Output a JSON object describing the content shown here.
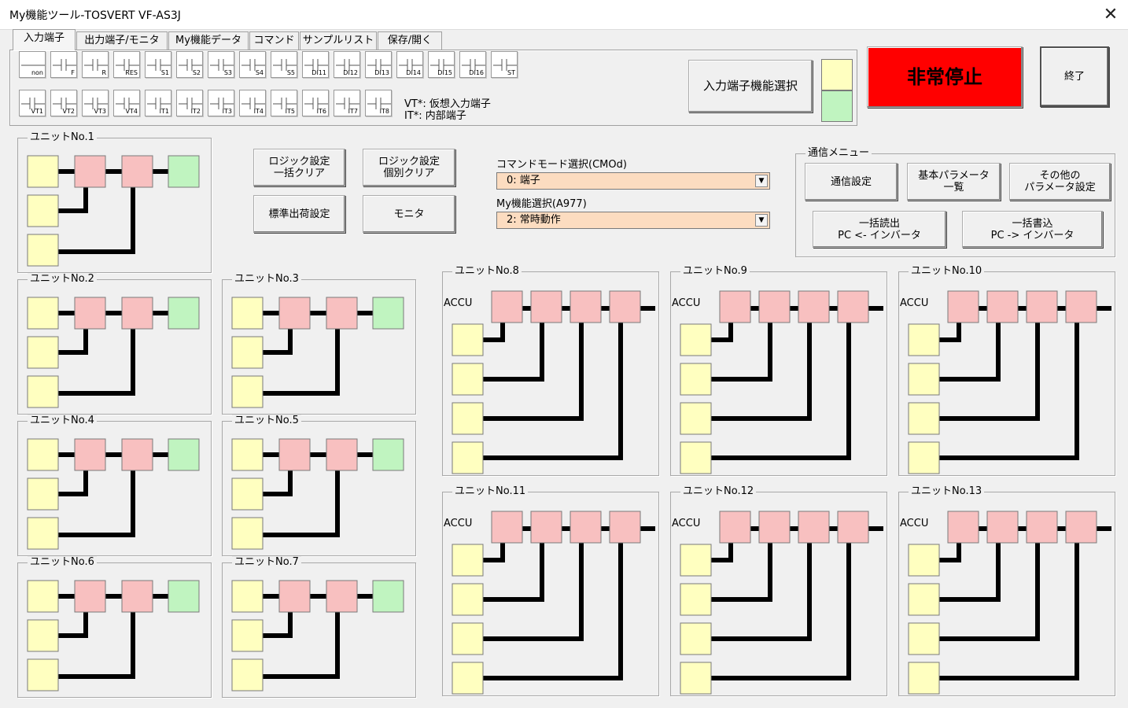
{
  "window": {
    "title": "My機能ツール-TOSVERT VF-AS3J",
    "close_glyph": "✕"
  },
  "tabs": [
    {
      "label": "入力端子",
      "active": true
    },
    {
      "label": "出力端子/モニタ",
      "active": false
    },
    {
      "label": "My機能データ",
      "active": false
    },
    {
      "label": "コマンド",
      "active": false
    },
    {
      "label": "サンプルリスト",
      "active": false
    },
    {
      "label": "保存/開く",
      "active": false
    }
  ],
  "terminals_row1": [
    "non",
    "F",
    "R",
    "RES",
    "S1",
    "S2",
    "S3",
    "S4",
    "S5",
    "DI11",
    "DI12",
    "DI13",
    "DI14",
    "DI15",
    "DI16",
    "ST"
  ],
  "terminals_row2": [
    "VT1",
    "VT2",
    "VT3",
    "VT4",
    "IT1",
    "IT2",
    "IT3",
    "IT4",
    "IT5",
    "IT6",
    "IT7",
    "IT8"
  ],
  "legend": {
    "vt": "VT*: 仮想入力端子",
    "it": "IT*: 内部端子"
  },
  "input_func_button": "入力端子機能選択",
  "emergency_button": "非常停止",
  "exit_button": "終了",
  "logic_buttons": {
    "bulk_clear": "ロジック設定\n一括クリア",
    "individual_clear": "ロジック設定\n個別クリア",
    "factory": "標準出荷設定",
    "monitor": "モニタ"
  },
  "command_mode": {
    "label": "コマンドモード選択(CMOd)",
    "value": "0: 端子"
  },
  "my_function": {
    "label": "My機能選択(A977)",
    "value": "2: 常時動作"
  },
  "comm_menu": {
    "title": "通信メニュー",
    "settings": "通信設定",
    "basic_params": "基本パラメータ\n一覧",
    "other_params": "その他の\nパラメータ設定",
    "bulk_read": "一括読出\nPC <- インバータ",
    "bulk_write": "一括書込\nPC -> インバータ"
  },
  "small_units": [
    {
      "title": "ユニットNo.1"
    },
    {
      "title": "ユニットNo.2"
    },
    {
      "title": "ユニットNo.3"
    },
    {
      "title": "ユニットNo.4"
    },
    {
      "title": "ユニットNo.5"
    },
    {
      "title": "ユニットNo.6"
    },
    {
      "title": "ユニットNo.7"
    }
  ],
  "large_units": [
    {
      "title": "ユニットNo.8"
    },
    {
      "title": "ユニットNo.9"
    },
    {
      "title": "ユニットNo.10"
    },
    {
      "title": "ユニットNo.11"
    },
    {
      "title": "ユニットNo.12"
    },
    {
      "title": "ユニットNo.13"
    }
  ],
  "accu_label": "ACCU",
  "colors": {
    "input_yellow": "#ffffc0",
    "logic_pink": "#f8c0c0",
    "output_green": "#c0f4c0",
    "emergency_red": "#ff0000",
    "dropdown_bg": "#fcdcc0"
  }
}
